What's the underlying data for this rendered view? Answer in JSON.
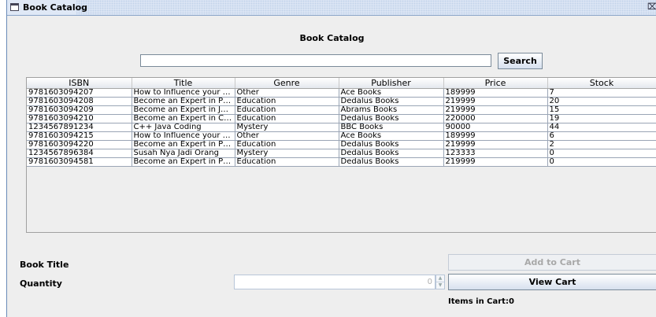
{
  "window": {
    "title": "Book Catalog",
    "close_glyph": "⌧"
  },
  "page": {
    "heading": "Book Catalog"
  },
  "search": {
    "value": "",
    "placeholder": "",
    "button_label": "Search"
  },
  "table": {
    "headers": [
      "ISBN",
      "Title",
      "Genre",
      "Publisher",
      "Price",
      "Stock"
    ],
    "rows": [
      [
        "9781603094207",
        "How to Influence your Friend",
        "Other",
        "Ace Books",
        "189999",
        "7"
      ],
      [
        "9781603094208",
        "Become an Expert in Python...",
        "Education",
        "Dedalus Books",
        "219999",
        "20"
      ],
      [
        "9781603094209",
        "Become an Expert in Java P...",
        "Education",
        "Abrams Books",
        "219999",
        "15"
      ],
      [
        "9781603094210",
        "Become an Expert in C Prog...",
        "Education",
        "Dedalus Books",
        "220000",
        "19"
      ],
      [
        "1234567891234",
        "C++ Java Coding",
        "Mystery",
        "BBC Books",
        "90000",
        "44"
      ],
      [
        "9781603094215",
        "How to Influence your Friend",
        "Other",
        "Ace Books",
        "189999",
        "6"
      ],
      [
        "9781603094220",
        "Become an Expert in Python...",
        "Education",
        "Dedalus Books",
        "219999",
        "2"
      ],
      [
        "1234567896384",
        "Susah Nya Jadi Orang",
        "Mystery",
        "Dedalus Books",
        "123333",
        "0"
      ],
      [
        "9781603094581",
        "Become an Expert in Python...",
        "Education",
        "Dedalus Books",
        "219999",
        "0"
      ]
    ]
  },
  "form": {
    "book_title_label": "Book Title",
    "quantity_label": "Quantity",
    "quantity_value": "0",
    "add_to_cart_label": "Add to Cart",
    "view_cart_label": "View Cart",
    "items_in_cart": "Items in Cart:0"
  },
  "icons": {
    "window": "window-icon",
    "close": "close-icon",
    "spinner_up": "spinner-up-icon",
    "spinner_down": "spinner-down-icon"
  }
}
